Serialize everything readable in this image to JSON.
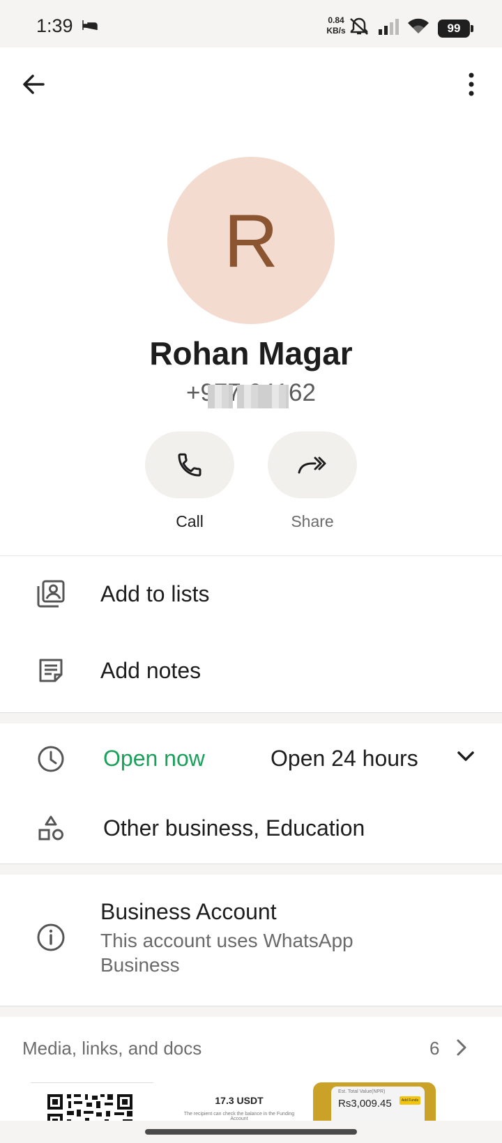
{
  "status_bar": {
    "time": "1:39",
    "net_speed_value": "0.84",
    "net_speed_unit": "KB/s",
    "battery": "99",
    "icons": [
      "sleep-icon",
      "bell-off-icon",
      "signal-icon",
      "wifi-icon",
      "battery-icon"
    ]
  },
  "header": {
    "back_icon": "arrow-left-icon",
    "more_icon": "more-vert-icon"
  },
  "contact": {
    "initial": "R",
    "name": "Rohan Magar",
    "phone": "+977          64162",
    "avatar_bg": "#f3dccf",
    "avatar_fg": "#8b5532"
  },
  "actions": [
    {
      "label": "Call",
      "icon": "phone-icon"
    },
    {
      "label": "Share",
      "icon": "share-forward-icon"
    }
  ],
  "list_options": [
    {
      "label": "Add to lists",
      "icon": "contacts-list-icon"
    },
    {
      "label": "Add notes",
      "icon": "notes-icon"
    }
  ],
  "business_info": {
    "hours_status": "Open now",
    "hours_status_color": "#1aa05a",
    "hours_detail": "Open 24 hours",
    "category": "Other business, Education"
  },
  "business_account": {
    "title": "Business Account",
    "subtitle": "This account uses WhatsApp Business"
  },
  "media": {
    "title": "Media, links, and docs",
    "count": "6",
    "thumb_usdt_amount": "17.3 USDT",
    "thumb_usdt_sub": "The recipient can check the balance in the Funding Account",
    "thumb_photo_label": "Est. Total Value(NPR)",
    "thumb_photo_amount": "Rs3,009.45",
    "thumb_photo_button": "Add Funds"
  }
}
